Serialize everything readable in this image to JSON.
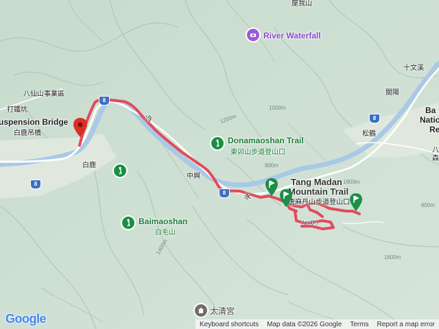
{
  "map": {
    "labels": {
      "bxs": "八仙山事業區",
      "daqiekeng": "打鐵坑",
      "suspension_en": "uspension Bridge",
      "suspension_zh": "白鹿吊橋",
      "bailu": "白鹿",
      "river_waterfall": "River Waterfall",
      "donamaoshan_en": "Donamaoshan Trail",
      "donamaoshan_zh": "東卯山步道登山口",
      "tang_madan_line1": "Tang Madan",
      "tang_madan_line2": "Mountain Trail",
      "tang_madan_zh": "唐麻丹山步道登山口",
      "baimaoshan_en": "Baimaoshan",
      "baimaoshan_zh": "白毛山",
      "taiqinggong": "太清宮",
      "zhongxing": "中興",
      "songhe": "松鶴",
      "lixian_top": "十文溪",
      "guanyang": "關陽",
      "right_cut_1": "Ba",
      "right_cut_2": "Natio",
      "right_cut_3": "Re",
      "right_cut_4": "八",
      "right_cut_5": "森",
      "top_cut": "屋我山",
      "lengkeng": "冷",
      "yong": "永",
      "small_label": "Aeol(P)"
    },
    "elevations": [
      "1200m",
      "1000m",
      "800m",
      "1400m",
      "1600m",
      "1800m",
      "600m"
    ],
    "shields": {
      "route8_a": "8",
      "route8_b": "8"
    },
    "colors": {
      "route": "#e24a5c",
      "river": "#a9c9e6",
      "road": "#ffffff",
      "flag_green": "#1b8f44",
      "destination": "#d93025",
      "terrain": "#cfe0d4",
      "ridge": "#b2c9b9"
    },
    "icons": {
      "start_pin": "destination-pin-icon",
      "waypoint": "green-flag-icon",
      "poi_hiking": "hiking-icon",
      "poi_waterfall": "camera-icon",
      "poi_temple": "temple-icon"
    }
  },
  "google": {
    "logo": "Google"
  },
  "attribution": {
    "keyboard": "Keyboard shortcuts",
    "mapdata": "Map data ©2026 Google",
    "terms": "Terms",
    "report": "Report a map error"
  }
}
